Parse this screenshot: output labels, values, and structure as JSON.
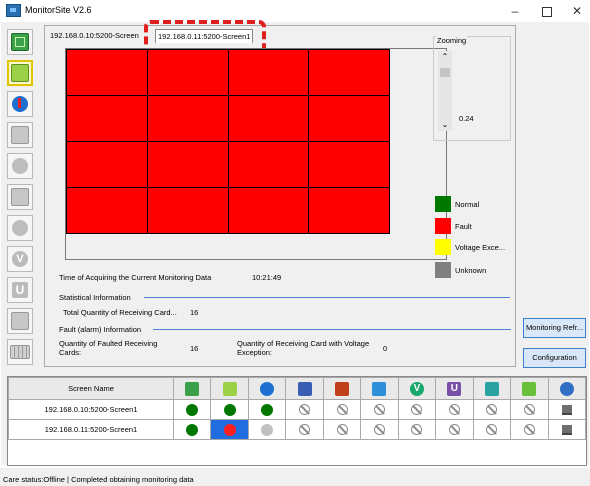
{
  "window": {
    "title": "MonitorSite V2.6",
    "minimize": "–",
    "close": "✕"
  },
  "tabs": [
    "192.168.0.10:5200-Screen",
    "192.168.0.11:5200-Screen1"
  ],
  "zoom": {
    "label": "Zooming",
    "value": "0.24",
    "up": "⌃",
    "down": "⌄"
  },
  "legend": [
    {
      "label": "Normal",
      "color": "#007800"
    },
    {
      "label": "Fault",
      "color": "#ff0000"
    },
    {
      "label": "Voltage Exce...",
      "color": "#ffff00"
    },
    {
      "label": "Unknown",
      "color": "#808080"
    }
  ],
  "info": {
    "acquire_label": "Time of Acquiring the Current Monitoring Data",
    "acquire_time": "10:21:49",
    "stat_title": "Statistical Information",
    "total_label": "Total Quantity of Receiving Card...",
    "total_value": "16",
    "fault_title": "Fault (alarm) Information",
    "faulted_label": "Quantity of Faulted Receiving Cards:",
    "faulted_value": "16",
    "voltage_label": "Quantity of Receiving Card with Voltage Exception:",
    "voltage_value": "0"
  },
  "buttons": {
    "refresh": "Monitoring Refr...",
    "configuration": "Configuration"
  },
  "table": {
    "header": "Screen Name",
    "icon_columns": [
      "card-icon",
      "receiving-card-icon",
      "temperature-icon",
      "cabinet-icon",
      "smoke-icon",
      "fan-icon",
      "voltage-icon",
      "magnet-icon",
      "door-icon",
      "module-icon",
      "globe-icon"
    ],
    "rows": [
      {
        "name": "192.168.0.10:5200-Screen1",
        "status": [
          "green",
          "green",
          "green",
          "na",
          "na",
          "na",
          "na",
          "na",
          "na",
          "na",
          "pc"
        ]
      },
      {
        "name": "192.168.0.11:5200-Screen1",
        "status": [
          "green",
          "red",
          "gray",
          "na",
          "na",
          "na",
          "na",
          "na",
          "na",
          "na",
          "pc"
        ]
      }
    ]
  },
  "status": {
    "text": "Care status:Offline  |  Completed obtaining monitoring data"
  },
  "colors": {
    "fault": "#fe0000",
    "normal": "#007800",
    "highlight": "#e01e1e"
  }
}
